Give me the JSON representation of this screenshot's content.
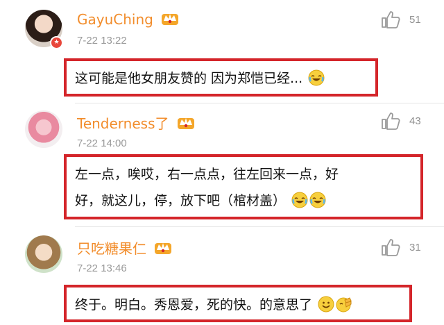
{
  "comments": [
    {
      "username": "GayuChing",
      "time": "7-22 13:22",
      "likes": "51",
      "text": "这可能是他女朋友赞的 因为郑恺已经...",
      "emojis": [
        "laugh-cry-emoji"
      ]
    },
    {
      "username": "Tenderness了",
      "time": "7-22 14:00",
      "likes": "43",
      "text_line1": "左一点，唉哎，右一点点，往左回来一点，好",
      "text_line2": "好，就这儿，停，放下吧（棺材盖）",
      "emojis": [
        "laugh-cry-emoji",
        "laugh-cry-emoji"
      ]
    },
    {
      "username": "只吃糖果仁",
      "time": "7-22 13:46",
      "likes": "31",
      "text": "终于。明白。秀恩爱，死的快。的意思了",
      "emojis": [
        "smile-emoji",
        "clap-emoji"
      ]
    }
  ],
  "colors": {
    "username": "#f28d2c",
    "highlight_box": "#d4252a",
    "timestamp": "#9a9a9a"
  }
}
